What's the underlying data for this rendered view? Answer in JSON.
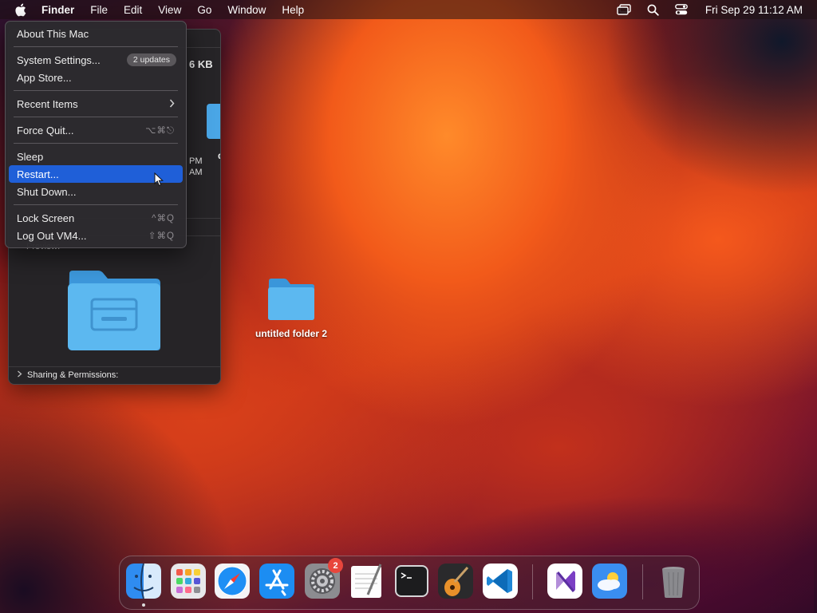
{
  "menubar": {
    "app_name": "Finder",
    "menus": [
      "File",
      "Edit",
      "View",
      "Go",
      "Window",
      "Help"
    ],
    "clock": "Fri Sep 29  11:12 AM",
    "icons": [
      "screen-mirroring-icon",
      "search-icon",
      "control-center-icon"
    ]
  },
  "apple_menu": {
    "items": {
      "about": "About This Mac",
      "settings": "System Settings...",
      "settings_badge": "2 updates",
      "app_store": "App Store...",
      "recent": "Recent Items",
      "force_quit": "Force Quit...",
      "force_quit_shortcut": "⌥⌘⎋",
      "sleep": "Sleep",
      "restart": "Restart...",
      "shutdown": "Shut Down...",
      "lock": "Lock Screen",
      "lock_shortcut": "^⌘Q",
      "logout": "Log Out VM4...",
      "logout_shortcut": "⇧⌘Q"
    },
    "highlighted": "Restart...",
    "highlight_color": "#1f5fd8"
  },
  "info_window": {
    "size_fragment": "6 KB",
    "name_fragment_a": "r",
    "name_fragment_b": "der",
    "time_fragment_a": "PM",
    "time_fragment_b": "AM",
    "preview_label": "Preview:",
    "sharing_label": "Sharing & Permissions:"
  },
  "desktop": {
    "folder_label": "untitled folder 2"
  },
  "dock": {
    "apps": [
      "Finder",
      "Launchpad",
      "Safari",
      "App Store",
      "System Settings",
      "TextEdit",
      "Terminal",
      "GarageBand",
      "Visual Studio Code",
      "Visual Studio",
      "Weather",
      "Trash"
    ],
    "settings_badge": "2"
  }
}
